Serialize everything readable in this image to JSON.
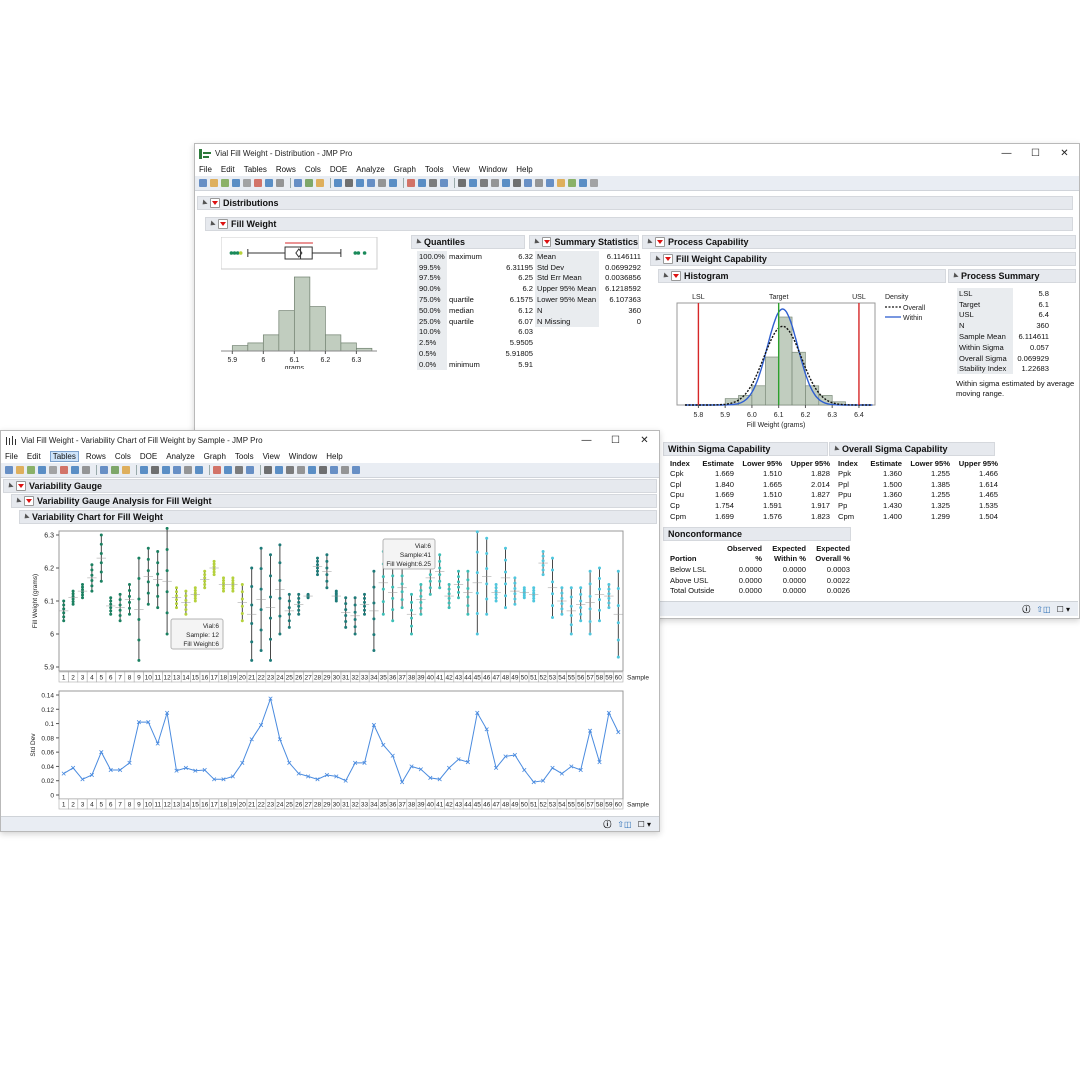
{
  "dist_window": {
    "title": "Vial Fill Weight - Distribution - JMP Pro",
    "menu": [
      "File",
      "Edit",
      "Tables",
      "Rows",
      "Cols",
      "DOE",
      "Analyze",
      "Graph",
      "Tools",
      "View",
      "Window",
      "Help"
    ],
    "distributions_title": "Distributions",
    "fill_weight_title": "Fill Weight",
    "xaxis_label": "grams",
    "xticks": [
      "5.9",
      "6",
      "6.1",
      "6.2",
      "6.3"
    ],
    "quantiles": {
      "title": "Quantiles",
      "rows": [
        [
          "100.0%",
          "maximum",
          "6.32"
        ],
        [
          "99.5%",
          "",
          "6.31195"
        ],
        [
          "97.5%",
          "",
          "6.25"
        ],
        [
          "90.0%",
          "",
          "6.2"
        ],
        [
          "75.0%",
          "quartile",
          "6.1575"
        ],
        [
          "50.0%",
          "median",
          "6.12"
        ],
        [
          "25.0%",
          "quartile",
          "6.07"
        ],
        [
          "10.0%",
          "",
          "6.03"
        ],
        [
          "2.5%",
          "",
          "5.9505"
        ],
        [
          "0.5%",
          "",
          "5.91805"
        ],
        [
          "0.0%",
          "minimum",
          "5.91"
        ]
      ]
    },
    "summary": {
      "title": "Summary Statistics",
      "rows": [
        [
          "Mean",
          "6.1146111"
        ],
        [
          "Std Dev",
          "0.0699292"
        ],
        [
          "Std Err Mean",
          "0.0036856"
        ],
        [
          "Upper 95% Mean",
          "6.1218592"
        ],
        [
          "Lower 95% Mean",
          "6.107363"
        ],
        [
          "N",
          "360"
        ],
        [
          "N Missing",
          "0"
        ]
      ]
    },
    "capability": {
      "title": "Process Capability",
      "sub_title": "Fill Weight Capability",
      "histogram_title": "Histogram",
      "labels": {
        "lsl": "LSL",
        "target": "Target",
        "usl": "USL"
      },
      "legend": {
        "title": "Density",
        "overall": "Overall",
        "within": "Within"
      },
      "xticks": [
        "5.8",
        "5.9",
        "6.0",
        "6.1",
        "6.2",
        "6.3",
        "6.4"
      ],
      "xlabel": "Fill Weight (grams)",
      "process_summary": {
        "title": "Process Summary",
        "rows": [
          [
            "LSL",
            "5.8"
          ],
          [
            "Target",
            "6.1"
          ],
          [
            "USL",
            "6.4"
          ],
          [
            "N",
            "360"
          ],
          [
            "Sample Mean",
            "6.114611"
          ],
          [
            "Within Sigma",
            "0.057"
          ],
          [
            "Overall Sigma",
            "0.069929"
          ],
          [
            "Stability Index",
            "1.22683"
          ]
        ],
        "note": "Within sigma estimated by average moving range."
      },
      "within": {
        "title": "Within Sigma Capability",
        "headers": [
          "Index",
          "Estimate",
          "Lower 95%",
          "Upper 95%"
        ],
        "rows": [
          [
            "Cpk",
            "1.669",
            "1.510",
            "1.828"
          ],
          [
            "Cpl",
            "1.840",
            "1.665",
            "2.014"
          ],
          [
            "Cpu",
            "1.669",
            "1.510",
            "1.827"
          ],
          [
            "Cp",
            "1.754",
            "1.591",
            "1.917"
          ],
          [
            "Cpm",
            "1.699",
            "1.576",
            "1.823"
          ]
        ]
      },
      "overall": {
        "title": "Overall Sigma Capability",
        "headers": [
          "Index",
          "Estimate",
          "Lower 95%",
          "Upper 95%"
        ],
        "rows": [
          [
            "Ppk",
            "1.360",
            "1.255",
            "1.466"
          ],
          [
            "Ppl",
            "1.500",
            "1.385",
            "1.614"
          ],
          [
            "Ppu",
            "1.360",
            "1.255",
            "1.465"
          ],
          [
            "Pp",
            "1.430",
            "1.325",
            "1.535"
          ],
          [
            "Cpm",
            "1.400",
            "1.299",
            "1.504"
          ]
        ]
      },
      "nonconformance": {
        "title": "Nonconformance",
        "headers": [
          "Portion",
          "Observed %",
          "Expected Within %",
          "Expected Overall %"
        ],
        "rows": [
          [
            "Below LSL",
            "0.0000",
            "0.0000",
            "0.0003"
          ],
          [
            "Above USL",
            "0.0000",
            "0.0000",
            "0.0022"
          ],
          [
            "Total Outside",
            "0.0000",
            "0.0000",
            "0.0026"
          ]
        ]
      }
    }
  },
  "var_window": {
    "title": "Vial Fill Weight - Variability Chart of Fill Weight by Sample - JMP Pro",
    "menu": [
      "File",
      "Edit",
      "Tables",
      "Rows",
      "Cols",
      "DOE",
      "Analyze",
      "Graph",
      "Tools",
      "View",
      "Window",
      "Help"
    ],
    "selected_menu": "Tables",
    "gauge_title": "Variability Gauge",
    "analysis_title": "Variability Gauge Analysis for Fill Weight",
    "chart_title": "Variability Chart for Fill Weight",
    "tooltip1": {
      "line1": "Vial:6",
      "line2": "Sample:41",
      "line3": "Fill Weight:6.25"
    },
    "tooltip2": {
      "line1": "Vial:6",
      "line2": "Sample: 12",
      "line3": "Fill Weight:6"
    },
    "sample_label": "Sample"
  },
  "chart_data": [
    {
      "type": "bar",
      "title": "",
      "xlabel": "grams",
      "bins": [
        5.9,
        5.95,
        6.0,
        6.05,
        6.1,
        6.15,
        6.2,
        6.25,
        6.3,
        6.35
      ],
      "values": [
        4,
        6,
        12,
        30,
        55,
        33,
        12,
        6,
        2
      ],
      "xlim": [
        5.87,
        6.36
      ]
    },
    {
      "type": "scatter",
      "title": "Variability Chart for Fill Weight",
      "xlabel": "Sample",
      "ylabel": "Fill Weight (grams)",
      "ylim": [
        5.9,
        6.3
      ],
      "yticks": [
        5.9,
        6,
        6.1,
        6.2,
        6.3
      ],
      "x": [
        1,
        2,
        3,
        4,
        5,
        6,
        7,
        8,
        9,
        10,
        11,
        12,
        13,
        14,
        15,
        16,
        17,
        18,
        19,
        20,
        21,
        22,
        23,
        24,
        25,
        26,
        27,
        28,
        29,
        30,
        31,
        32,
        33,
        34,
        35,
        36,
        37,
        38,
        39,
        40,
        41,
        42,
        43,
        44,
        45,
        46,
        47,
        48,
        49,
        50,
        51,
        52,
        53,
        54,
        55,
        56,
        57,
        58,
        59,
        60
      ],
      "series": [
        {
          "name": "min",
          "values": [
            6.04,
            6.09,
            6.11,
            6.13,
            6.16,
            6.06,
            6.04,
            6.06,
            5.92,
            6.09,
            6.08,
            6.0,
            6.08,
            6.06,
            6.1,
            6.14,
            6.18,
            6.13,
            6.13,
            6.04,
            5.92,
            5.95,
            5.92,
            6.0,
            6.02,
            6.06,
            6.11,
            6.18,
            6.14,
            6.1,
            6.02,
            6.0,
            6.06,
            5.95,
            6.06,
            6.04,
            6.08,
            6.0,
            6.06,
            6.12,
            6.14,
            6.08,
            6.11,
            6.06,
            6.0,
            6.06,
            6.1,
            6.08,
            6.09,
            6.11,
            6.1,
            6.18,
            6.05,
            6.06,
            6.0,
            6.04,
            6.0,
            6.04,
            6.08,
            5.93
          ]
        },
        {
          "name": "max",
          "values": [
            6.1,
            6.13,
            6.15,
            6.21,
            6.3,
            6.11,
            6.12,
            6.15,
            6.23,
            6.26,
            6.25,
            6.32,
            6.14,
            6.13,
            6.14,
            6.19,
            6.22,
            6.17,
            6.17,
            6.15,
            6.2,
            6.26,
            6.24,
            6.27,
            6.12,
            6.12,
            6.12,
            6.23,
            6.24,
            6.13,
            6.11,
            6.11,
            6.12,
            6.19,
            6.25,
            6.21,
            6.2,
            6.12,
            6.15,
            6.22,
            6.24,
            6.15,
            6.19,
            6.19,
            6.31,
            6.29,
            6.15,
            6.26,
            6.17,
            6.14,
            6.14,
            6.25,
            6.23,
            6.14,
            6.14,
            6.14,
            6.19,
            6.2,
            6.15,
            6.19
          ]
        }
      ]
    },
    {
      "type": "line",
      "title": "",
      "xlabel": "Sample",
      "ylabel": "Std Dev",
      "ylim": [
        0,
        0.14
      ],
      "yticks": [
        0,
        0.02,
        0.04,
        0.06,
        0.08,
        0.1,
        0.12,
        0.14
      ],
      "x": [
        1,
        2,
        3,
        4,
        5,
        6,
        7,
        8,
        9,
        10,
        11,
        12,
        13,
        14,
        15,
        16,
        17,
        18,
        19,
        20,
        21,
        22,
        23,
        24,
        25,
        26,
        27,
        28,
        29,
        30,
        31,
        32,
        33,
        34,
        35,
        36,
        37,
        38,
        39,
        40,
        41,
        42,
        43,
        44,
        45,
        46,
        47,
        48,
        49,
        50,
        51,
        52,
        53,
        54,
        55,
        56,
        57,
        58,
        59,
        60
      ],
      "values": [
        0.03,
        0.038,
        0.022,
        0.028,
        0.06,
        0.035,
        0.035,
        0.045,
        0.102,
        0.102,
        0.072,
        0.115,
        0.034,
        0.038,
        0.034,
        0.035,
        0.022,
        0.022,
        0.026,
        0.045,
        0.078,
        0.098,
        0.135,
        0.078,
        0.045,
        0.03,
        0.026,
        0.022,
        0.028,
        0.026,
        0.02,
        0.045,
        0.045,
        0.098,
        0.07,
        0.055,
        0.018,
        0.04,
        0.036,
        0.024,
        0.022,
        0.038,
        0.05,
        0.046,
        0.115,
        0.092,
        0.038,
        0.054,
        0.056,
        0.035,
        0.018,
        0.02,
        0.038,
        0.03,
        0.04,
        0.035,
        0.09,
        0.046,
        0.115,
        0.088
      ]
    }
  ],
  "colors": {
    "accent": "#1f6fb2",
    "bar": "#c1cdbf",
    "spec": "#d62728",
    "target": "#2ca02c",
    "within": "#2f5fd0",
    "series_line": "#4a8bdf"
  }
}
